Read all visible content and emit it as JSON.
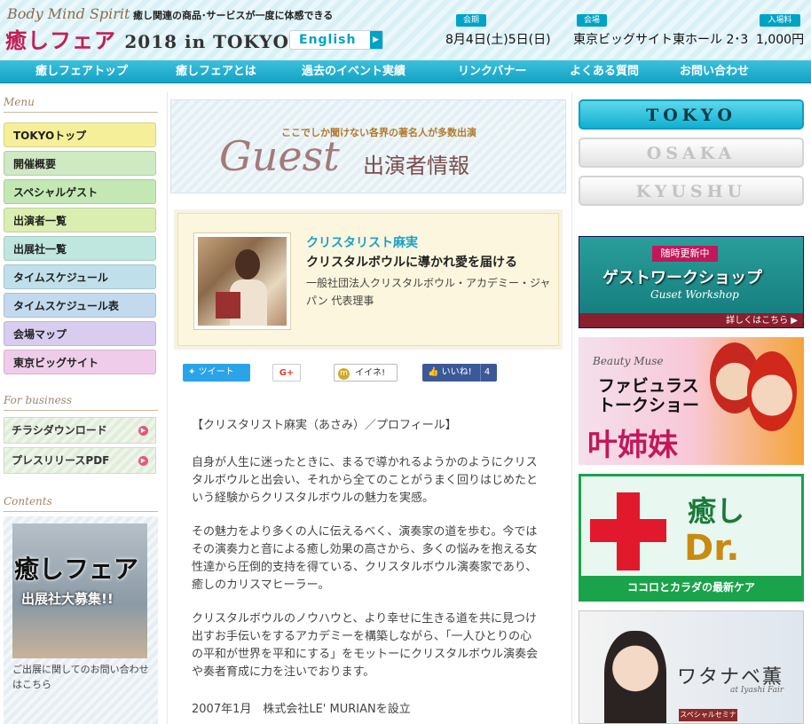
{
  "header": {
    "tag": "Body Mind Spirit",
    "tagline": "癒し関連の商品･サービスが一度に体感できる",
    "title_main": "癒しフェア",
    "title_year": "2018 in TOKYO",
    "english_label": "English",
    "info": [
      {
        "label": "会期",
        "value": "8月4日(土)5日(日)"
      },
      {
        "label": "会場",
        "value": "東京ビッグサイト東ホール 2･3"
      },
      {
        "label": "入場料",
        "value": "1,000円"
      }
    ],
    "accent": "#00a3c4",
    "brand_color": "#c21e54"
  },
  "nav": {
    "items": [
      "癒しフェアトップ",
      "癒しフェアとは",
      "過去のイベント実績",
      "リンクバナー",
      "よくある質問",
      "お問い合わせ"
    ]
  },
  "sidebar": {
    "menu_heading": "Menu",
    "menu": [
      {
        "label": "TOKYOトップ",
        "color": "#f6ef9a"
      },
      {
        "label": "開催概要",
        "color": "#cfe9c3"
      },
      {
        "label": "スペシャルゲスト",
        "color": "#c4e8b4"
      },
      {
        "label": "出演者一覧",
        "color": "#dbeeb1"
      },
      {
        "label": "出展社一覧",
        "color": "#bfe6df"
      },
      {
        "label": "タイムスケジュール",
        "color": "#bfe0ea"
      },
      {
        "label": "タイムスケジュール表",
        "color": "#c2d9ee"
      },
      {
        "label": "会場マップ",
        "color": "#d8cdef"
      },
      {
        "label": "東京ビッグサイト",
        "color": "#efcdea"
      }
    ],
    "business_heading": "For business",
    "business": [
      "チラシダウンロード",
      "プレスリリースPDF"
    ],
    "contents_heading": "Contents",
    "recruit_title": "癒しフェア",
    "recruit_sub": "出展社大募集!!",
    "recruit_text": "ご出展に関してのお問い合わせはこちら"
  },
  "main": {
    "banner_sub": "ここでしか聞けない各界の著名人が多数出演",
    "banner_word": "Guest",
    "banner_jp": "出演者情報",
    "profile": {
      "name": "クリスタリスト麻実",
      "title": "クリスタルボウルに導かれ愛を届ける",
      "org": "一般社団法人クリスタルボウル・アカデミー・ジャパン 代表理事"
    },
    "share": {
      "tweet": "ツイート",
      "gplus": "G+",
      "mixi": "イイネ!",
      "fb": "いいね!",
      "fb_count": "4"
    },
    "bio": [
      "【クリスタリスト麻実（あさみ）／プロフィール】",
      "自身が人生に迷ったときに、まるで導かれるようかのようにクリスタルボウルと出会い、それから全てのことがうまく回りはじめたという経験からクリスタルボウルの魅力を実感。",
      "その魅力をより多くの人に伝えるべく、演奏家の道を歩む。今ではその演奏力と音による癒し効果の高さから、多くの悩みを抱える女性達から圧倒的支持を得ている、クリスタルボウル演奏家であり、癒しのカリスマヒーラー。",
      "クリスタルボウルのノウハウと、より幸せに生きる道を共に見つけ出すお手伝いをするアカデミーを構築しながら、「一人ひとりの心の平和が世界を平和にする」をモットーにクリスタルボウル演奏会や奏者育成に力を注いでおります。",
      "2007年1月　株式会社LE' MURIANを設立"
    ]
  },
  "right": {
    "cities": [
      "TOKYO",
      "OSAKA",
      "KYUSHU"
    ],
    "workshop": {
      "badge": "随時更新中",
      "title": "ゲストワークショップ",
      "sub": "Guset Workshop",
      "more": "詳しくはこちら ▶"
    },
    "kano": {
      "small": "Beauty Muse",
      "title1": "ファビュラス",
      "title2": "トークショー",
      "name": "叶姉妹"
    },
    "doctor": {
      "t1": "癒し",
      "t2": "Dr.",
      "bar": "ココロとカラダの最新ケア"
    },
    "watanabe": {
      "name": "ワタナベ薫",
      "sub": "at Iyashi Fair",
      "badge": "スペシャルセミナー"
    }
  }
}
